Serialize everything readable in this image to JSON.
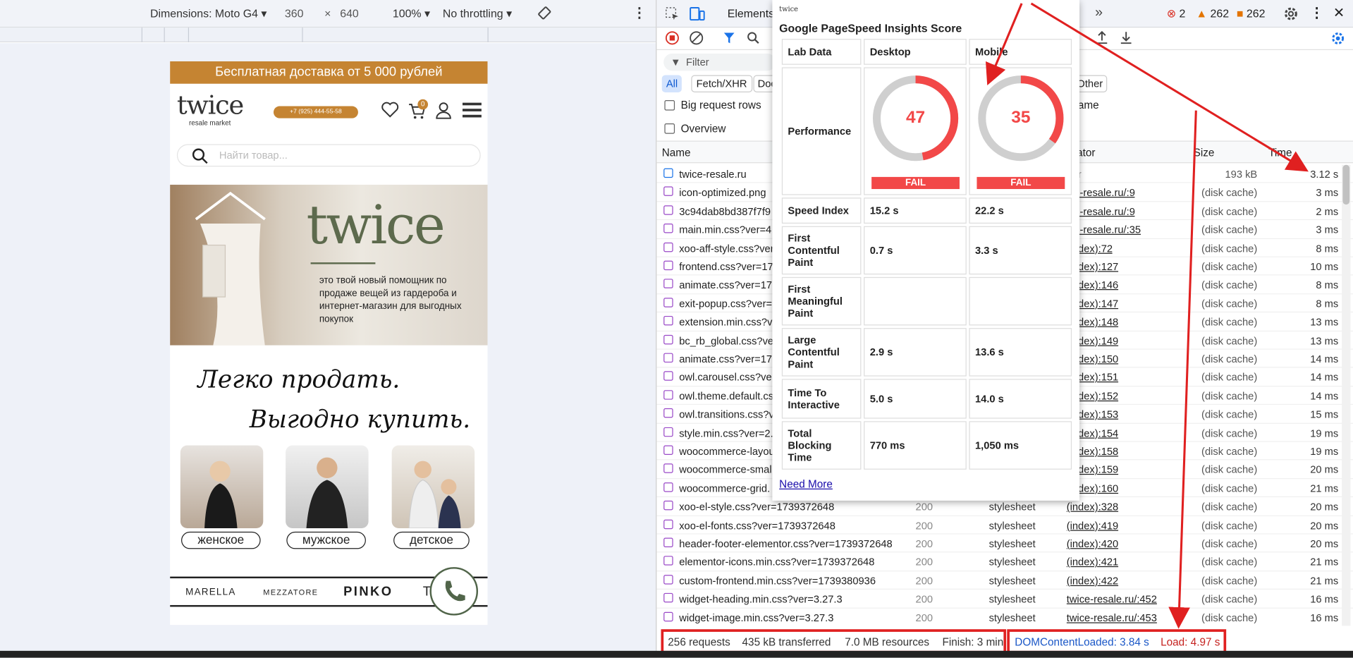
{
  "toolbar": {
    "dimensions": "Dimensions: Moto G4",
    "width": "360",
    "x": "×",
    "height": "640",
    "zoom": "100%",
    "throttle": "No throttling"
  },
  "site": {
    "banner": "Бесплатная доставка от 5 000 рублей",
    "logo": "twice",
    "logo_sub": "resale market",
    "phone": "+7 (925) 444-55-58",
    "cart_count": "0",
    "search_placeholder": "Найти товар...",
    "hero_logo": "twice",
    "hero_text": "это твой новый помощник по продаже вещей из гардероба и интернет-магазин для выгодных покупок",
    "script_line1": "Легко продать.",
    "script_line2": "Выгодно купить.",
    "cats": [
      "женское",
      "мужское",
      "детское"
    ],
    "brands": [
      "MARELLA",
      "MEZZATORE",
      "PINKO",
      "T"
    ]
  },
  "devtools": {
    "tab_elements": "Elements",
    "more": "»",
    "errors": "2",
    "warnings": "262",
    "issues": "262",
    "filter": "Filter",
    "chips": [
      "All",
      "Fetch/XHR",
      "Doc",
      "Other"
    ],
    "big_rows": "Big request rows",
    "overview": "Overview",
    "frame": "rame",
    "s": "s",
    "col_name": "Name",
    "col_initiator": "iator",
    "col_size": "Size",
    "col_time": "Time",
    "rows": [
      {
        "name": "twice-resale.ru",
        "status": "",
        "type": "",
        "init": "her",
        "size": "193 kB",
        "time": "3.12 s"
      },
      {
        "name": "icon-optimized.png",
        "status": "",
        "type": "",
        "init": "ice-resale.ru/:9",
        "size": "(disk cache)",
        "time": "3 ms"
      },
      {
        "name": "3c94dab8bd387f7f9",
        "status": "",
        "type": "",
        "init": "ice-resale.ru/:9",
        "size": "(disk cache)",
        "time": "2 ms"
      },
      {
        "name": "main.min.css?ver=4.",
        "status": "",
        "type": "",
        "init": "ice-resale.ru/:35",
        "size": "(disk cache)",
        "time": "3 ms"
      },
      {
        "name": "xoo-aff-style.css?ver",
        "status": "",
        "type": "",
        "init": "(index):72",
        "size": "(disk cache)",
        "time": "8 ms"
      },
      {
        "name": "frontend.css?ver=17",
        "status": "",
        "type": "",
        "init": "(index):127",
        "size": "(disk cache)",
        "time": "10 ms"
      },
      {
        "name": "animate.css?ver=173",
        "status": "",
        "type": "",
        "init": "(index):146",
        "size": "(disk cache)",
        "time": "8 ms"
      },
      {
        "name": "exit-popup.css?ver=",
        "status": "",
        "type": "",
        "init": "(index):147",
        "size": "(disk cache)",
        "time": "8 ms"
      },
      {
        "name": "extension.min.css?ver",
        "status": "",
        "type": "",
        "init": "(index):148",
        "size": "(disk cache)",
        "time": "13 ms"
      },
      {
        "name": "bc_rb_global.css?ver",
        "status": "",
        "type": "",
        "init": "(index):149",
        "size": "(disk cache)",
        "time": "13 ms"
      },
      {
        "name": "animate.css?ver=173",
        "status": "",
        "type": "",
        "init": "(index):150",
        "size": "(disk cache)",
        "time": "14 ms"
      },
      {
        "name": "owl.carousel.css?ver",
        "status": "",
        "type": "",
        "init": "(index):151",
        "size": "(disk cache)",
        "time": "14 ms"
      },
      {
        "name": "owl.theme.default.css",
        "status": "",
        "type": "",
        "init": "(index):152",
        "size": "(disk cache)",
        "time": "14 ms"
      },
      {
        "name": "owl.transitions.css?ve",
        "status": "",
        "type": "",
        "init": "(index):153",
        "size": "(disk cache)",
        "time": "15 ms"
      },
      {
        "name": "style.min.css?ver=2.6",
        "status": "",
        "type": "",
        "init": "(index):154",
        "size": "(disk cache)",
        "time": "19 ms"
      },
      {
        "name": "woocommerce-layou",
        "status": "",
        "type": "",
        "init": "(index):158",
        "size": "(disk cache)",
        "time": "19 ms"
      },
      {
        "name": "woocommerce-smal",
        "status": "",
        "type": "",
        "init": "(index):159",
        "size": "(disk cache)",
        "time": "20 ms"
      },
      {
        "name": "woocommerce-grid.",
        "status": "",
        "type": "",
        "init": "(index):160",
        "size": "(disk cache)",
        "time": "21 ms"
      },
      {
        "name": "xoo-el-style.css?ver=1739372648",
        "status": "200",
        "type": "stylesheet",
        "init": "(index):328",
        "size": "(disk cache)",
        "time": "20 ms"
      },
      {
        "name": "xoo-el-fonts.css?ver=1739372648",
        "status": "200",
        "type": "stylesheet",
        "init": "(index):419",
        "size": "(disk cache)",
        "time": "20 ms"
      },
      {
        "name": "header-footer-elementor.css?ver=1739372648",
        "status": "200",
        "type": "stylesheet",
        "init": "(index):420",
        "size": "(disk cache)",
        "time": "20 ms"
      },
      {
        "name": "elementor-icons.min.css?ver=1739372648",
        "status": "200",
        "type": "stylesheet",
        "init": "(index):421",
        "size": "(disk cache)",
        "time": "21 ms"
      },
      {
        "name": "custom-frontend.min.css?ver=1739380936",
        "status": "200",
        "type": "stylesheet",
        "init": "(index):422",
        "size": "(disk cache)",
        "time": "21 ms"
      },
      {
        "name": "widget-heading.min.css?ver=3.27.3",
        "status": "200",
        "type": "stylesheet",
        "init": "twice-resale.ru/:452",
        "size": "(disk cache)",
        "time": "16 ms"
      },
      {
        "name": "widget-image.min.css?ver=3.27.3",
        "status": "200",
        "type": "stylesheet",
        "init": "twice-resale.ru/:453",
        "size": "(disk cache)",
        "time": "16 ms"
      }
    ],
    "status": {
      "requests": "256 requests",
      "transferred": "435 kB transferred",
      "resources": "7.0 MB resources",
      "finish": "Finish: 3 min",
      "dcl": "DOMContentLoaded: 3.84 s",
      "load": "Load: 4.97 s"
    }
  },
  "psi": {
    "mini_logo": "twice",
    "title": "Google PageSpeed Insights Score",
    "col0": "Lab Data",
    "col1": "Desktop",
    "col2": "Mobile",
    "perf_label": "Performance",
    "desktop_score": "47",
    "mobile_score": "35",
    "desktop_score_value": 47,
    "mobile_score_value": 35,
    "fail": "FAIL",
    "metrics": [
      {
        "label": "Speed Index",
        "desktop": "15.2 s",
        "mobile": "22.2 s"
      },
      {
        "label": "First Contentful Paint",
        "desktop": "0.7 s",
        "mobile": "3.3 s"
      },
      {
        "label": "First Meaningful Paint",
        "desktop": "",
        "mobile": ""
      },
      {
        "label": "Large Contentful Paint",
        "desktop": "2.9 s",
        "mobile": "13.6 s"
      },
      {
        "label": "Time To Interactive",
        "desktop": "5.0 s",
        "mobile": "14.0 s"
      },
      {
        "label": "Total Blocking Time",
        "desktop": "770 ms",
        "mobile": "1,050 ms"
      }
    ],
    "need_more": "Need More"
  },
  "colors": {
    "accent": "#c58432",
    "fail": "#f24848",
    "dt_blue": "#1a73e8",
    "annot_red": "#e02020"
  }
}
